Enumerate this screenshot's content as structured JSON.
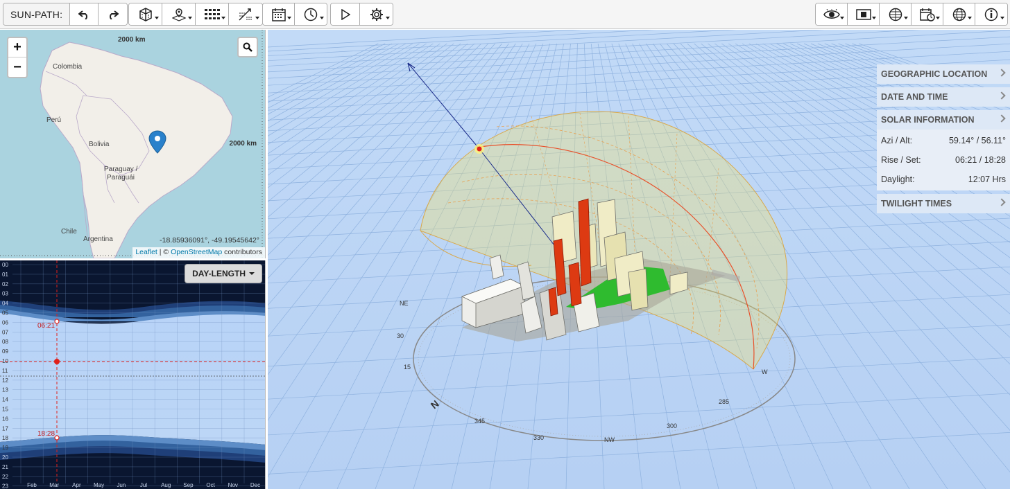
{
  "toolbar": {
    "app_label": "SUN-PATH:",
    "left_groups": [
      {
        "buttons": [
          {
            "icon": "undo-icon"
          },
          {
            "icon": "redo-icon"
          }
        ]
      },
      {
        "buttons": [
          {
            "icon": "building-icon"
          },
          {
            "icon": "location-pin-icon"
          },
          {
            "icon": "grid-icon"
          },
          {
            "icon": "draw-tool-icon"
          }
        ]
      },
      {
        "buttons": [
          {
            "icon": "calendar-icon"
          },
          {
            "icon": "clock-icon"
          }
        ]
      },
      {
        "buttons": [
          {
            "icon": "play-icon"
          },
          {
            "icon": "gear-icon"
          }
        ]
      }
    ],
    "right_buttons": [
      {
        "icon": "eye-icon"
      },
      {
        "icon": "display-icon"
      },
      {
        "icon": "globe-grid-icon"
      },
      {
        "icon": "calendar-clock-icon"
      },
      {
        "icon": "globe-icon"
      },
      {
        "icon": "info-icon"
      }
    ]
  },
  "map": {
    "zoom_in": "+",
    "zoom_out": "−",
    "scale_top": "2000 km",
    "scale_right": "2000 km",
    "coordinates": "-18.85936091°, -49.19545642°",
    "attribution_leaflet": "Leaflet",
    "attribution_sep": " | © ",
    "attribution_osm": "OpenStreetMap",
    "attribution_contrib": " contributors",
    "countries": [
      "Colombia",
      "Perú",
      "Bolivia",
      "Paraguay /",
      "Paraguái",
      "Chile",
      "Argentina"
    ]
  },
  "day_length": {
    "button": "DAY-LENGTH",
    "hours": [
      "00",
      "01",
      "02",
      "03",
      "04",
      "05",
      "06",
      "07",
      "08",
      "09",
      "10",
      "11",
      "12",
      "13",
      "14",
      "15",
      "16",
      "17",
      "18",
      "19",
      "20",
      "21",
      "22",
      "23"
    ],
    "months": [
      "Feb",
      "Mar",
      "Apr",
      "May",
      "Jun",
      "Jul",
      "Aug",
      "Sep",
      "Oct",
      "Nov",
      "Dec"
    ],
    "sunrise_label": "06:21",
    "sunset_label": "18:28"
  },
  "panel": {
    "sections": [
      {
        "title": "GEOGRAPHIC LOCATION"
      },
      {
        "title": "DATE AND TIME"
      },
      {
        "title": "SOLAR INFORMATION",
        "rows": [
          {
            "label": "Azi / Alt:",
            "value": "59.14° / 56.11°"
          },
          {
            "label": "Rise / Set:",
            "value": "06:21 / 18:28"
          },
          {
            "label": "Daylight:",
            "value": "12:07 Hrs"
          }
        ]
      },
      {
        "title": "TWILIGHT TIMES"
      }
    ]
  },
  "compass": {
    "north": "N",
    "labels": [
      "345",
      "330",
      "NW",
      "300",
      "285",
      "W",
      "NE",
      "30",
      "15"
    ]
  },
  "colors": {
    "sun_dome": "#f4e26a",
    "sun_path": "#e8502a",
    "shadow_buildings": "#dd3a12",
    "ground_lit": "#2fbb2f",
    "sky": "#bcd6f6"
  }
}
